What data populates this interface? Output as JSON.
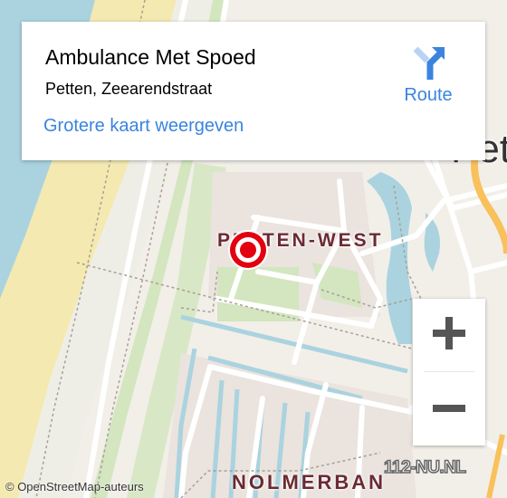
{
  "info_card": {
    "title": "Ambulance Met Spoed",
    "subtitle": "Petten, Zeearendstraat",
    "bigger_map_link": "Grotere kaart weergeven",
    "route_label": "Route",
    "route_icon": "directions-turn-right-icon"
  },
  "map": {
    "labels": {
      "district_1": "PETTEN-WEST",
      "district_2": "NOLMERBAN",
      "town_partial": "Pette"
    },
    "marker_icon": "location-target-icon",
    "colors": {
      "water": "#aad3df",
      "beach": "#f4e9b0",
      "land": "#f2efe9",
      "green": "#cfe5b6",
      "road": "#ffffff",
      "major_road": "#f8c15c",
      "marker": "#e3000f",
      "link": "#3a84df"
    }
  },
  "zoom_controls": {
    "zoom_in_icon": "plus-icon",
    "zoom_out_icon": "minus-icon"
  },
  "attribution": "© OpenStreetMap-auteurs",
  "watermark": "112-NU.NL"
}
